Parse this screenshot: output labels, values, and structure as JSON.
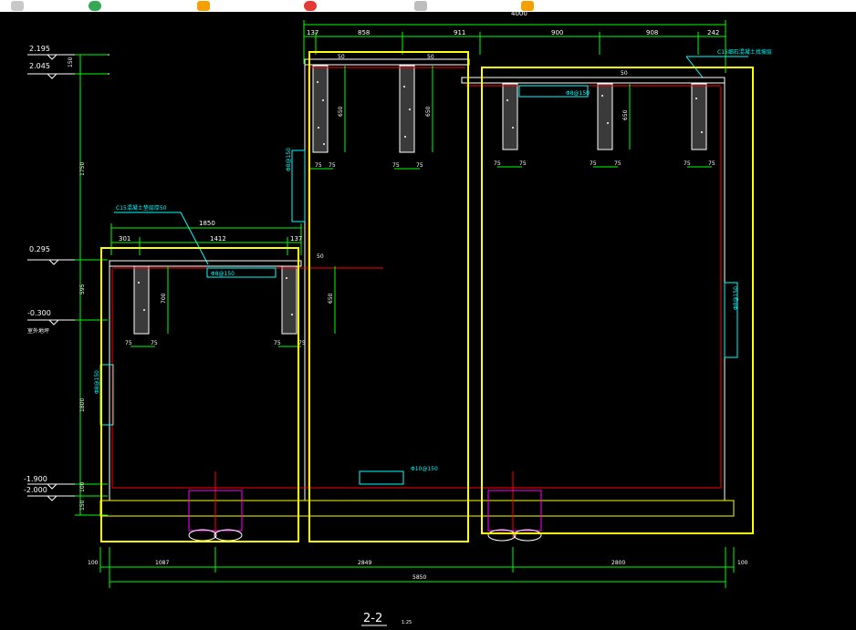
{
  "toolbar": {
    "icons": [
      {
        "name": "document-icon",
        "color": "#c8c8c8"
      },
      {
        "name": "chrome-icon",
        "color": "#34a853"
      },
      {
        "name": "folder-icon",
        "color": "#f4a000"
      },
      {
        "name": "record-icon",
        "color": "#e53935"
      },
      {
        "name": "page-icon",
        "color": "#bdbdbd"
      },
      {
        "name": "folder-icon-2",
        "color": "#f4a000"
      }
    ]
  },
  "drawing": {
    "top_total": "4000",
    "top_dims": [
      "137",
      "858",
      "911",
      "900",
      "908",
      "242"
    ],
    "left_level_1": "2.195",
    "left_level_2": "2.045",
    "left_dim_150a": "150",
    "left_dim_1750": "1750",
    "level_0295": "0.295",
    "left_dim_595": "595",
    "level_neg0300": "-0.300",
    "level_neg0300_sub": "室外地坪",
    "left_dim_1800": "1800",
    "level_neg1900": "-1.900",
    "level_neg2000": "-2.000",
    "left_dim_100": "100",
    "left_dim_150b": "150",
    "mid_top_dims": [
      "301",
      "1412",
      "137"
    ],
    "mid_total": "1850",
    "note_left_top": "C15混凝土垫层厚50",
    "note_right_top": "C15细石混凝土找坡层",
    "rebar_labels": [
      "Φ8@150",
      "Φ8@150",
      "Φ8@150",
      "Φ8@150",
      "Φ10@150",
      "Φ8@150"
    ],
    "beam_heights": [
      "650",
      "650",
      "650",
      "700",
      "650"
    ],
    "beam_side_dims": [
      "75",
      "75",
      "75",
      "75",
      "75",
      "75",
      "75",
      "75",
      "75",
      "75",
      "75",
      "75",
      "75",
      "75"
    ],
    "slab_dims": [
      "50",
      "50",
      "50",
      "50"
    ],
    "bottom_dims": [
      "100",
      "1087",
      "2849",
      "2800",
      "100"
    ],
    "bottom_total": "5850",
    "section_title": "2-2",
    "section_scale": "1:25"
  },
  "colors": {
    "highlight": "#ffff00",
    "dimension": "#00ff00",
    "rebar": "#ff0000",
    "annotation": "#00ffff",
    "pipe": "#ff00ff"
  }
}
